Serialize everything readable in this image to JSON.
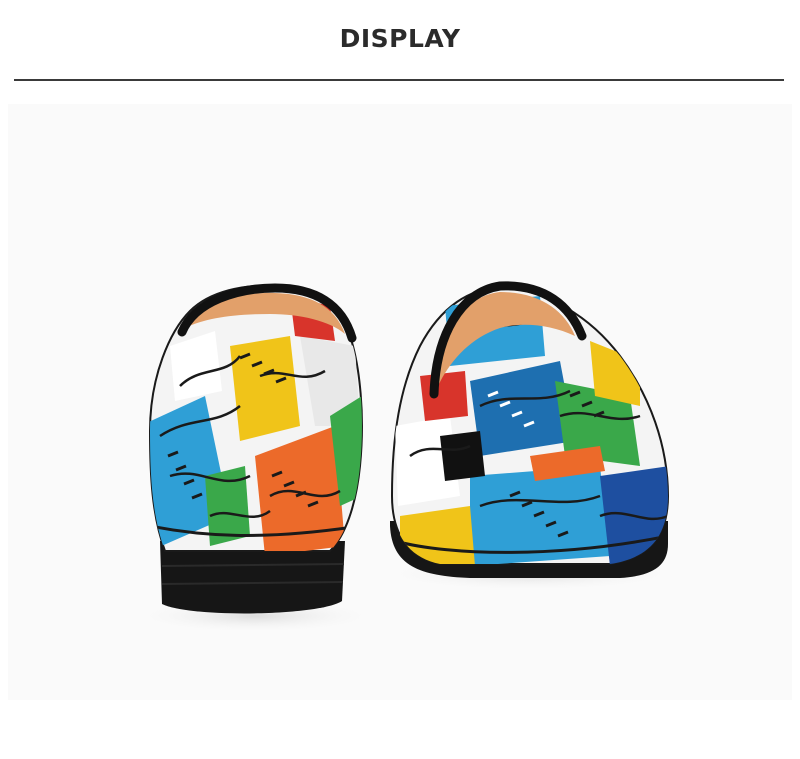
{
  "header": {
    "title": "DISPLAY"
  },
  "photo": {
    "subject": "pair-of-graffiti-print-loafers",
    "colors": {
      "background": "#fafafa",
      "sole": "#1a1a1a",
      "lining": "#e2a06a",
      "blue": "#2f9fd6",
      "yellow": "#f0c419",
      "green": "#3aa84a",
      "orange": "#ec6a2a",
      "red": "#d8342b"
    }
  }
}
